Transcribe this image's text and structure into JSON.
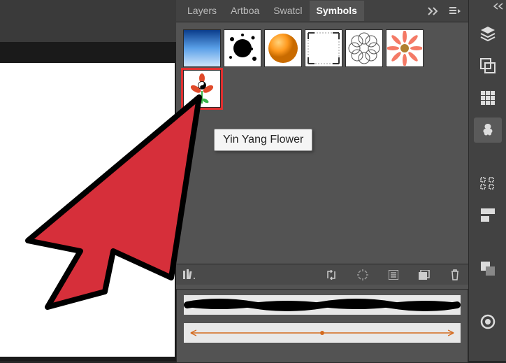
{
  "tabs": {
    "layers": "Layers",
    "artboards": "Artboa",
    "swatches": "Swatcl",
    "symbols": "Symbols"
  },
  "tooltip": "Yin Yang Flower",
  "symbols": [
    {
      "name": "Blue Gradient"
    },
    {
      "name": "Ink Splat"
    },
    {
      "name": "Orange Sphere"
    },
    {
      "name": "Registration Target"
    },
    {
      "name": "Ring Braid"
    },
    {
      "name": "Gerbera Daisy"
    },
    {
      "name": "Yin Yang Flower"
    }
  ],
  "dock": {
    "collapse": "Collapse",
    "layers": "Layers",
    "artboards": "Artboards",
    "swatches": "Swatches",
    "symbols": "Symbols",
    "align": "Align",
    "pathfinder": "Pathfinder",
    "shapes": "Shapes",
    "appearance": "Appearance"
  }
}
